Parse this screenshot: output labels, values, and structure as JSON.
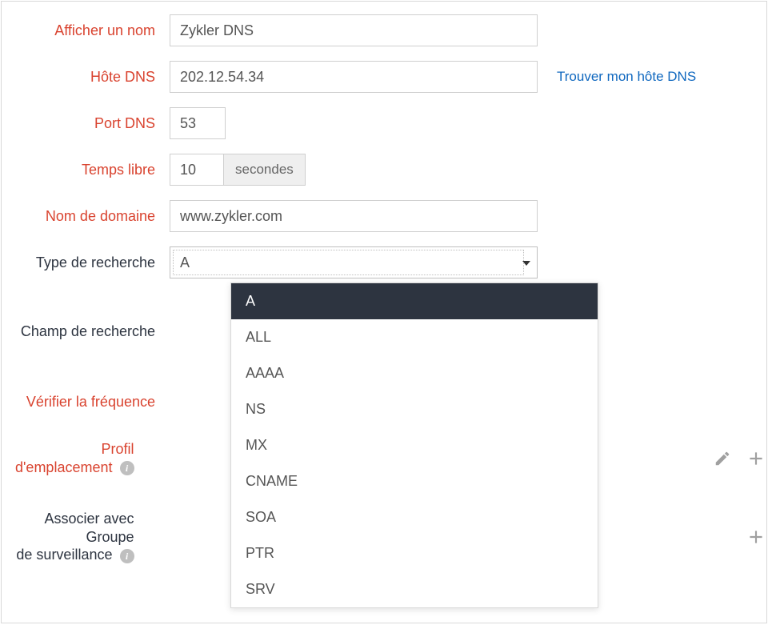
{
  "labels": {
    "display_name": "Afficher un nom",
    "dns_host": "Hôte DNS",
    "dns_port": "Port DNS",
    "timeout": "Temps libre",
    "domain_name": "Nom de domaine",
    "lookup_type": "Type de recherche",
    "search_field": "Champ de recherche",
    "check_frequency": "Vérifier la fréquence",
    "location_profile_line1": "Profil",
    "location_profile_line2": "d'emplacement",
    "monitor_group_line1": "Associer avec",
    "monitor_group_line2": "Groupe",
    "monitor_group_line3": "de surveillance"
  },
  "fields": {
    "display_name": "Zykler DNS",
    "dns_host": "202.12.54.34",
    "dns_port": "53",
    "timeout_value": "10",
    "timeout_unit": "secondes",
    "domain_name": "www.zykler.com",
    "lookup_type_selected": "A"
  },
  "links": {
    "find_my_dns": "Trouver mon hôte DNS"
  },
  "lookup_type_options": [
    "A",
    "ALL",
    "AAAA",
    "NS",
    "MX",
    "CNAME",
    "SOA",
    "PTR",
    "SRV"
  ],
  "icons": {
    "info": "info-icon",
    "edit": "pencil-icon",
    "add": "plus-icon"
  }
}
